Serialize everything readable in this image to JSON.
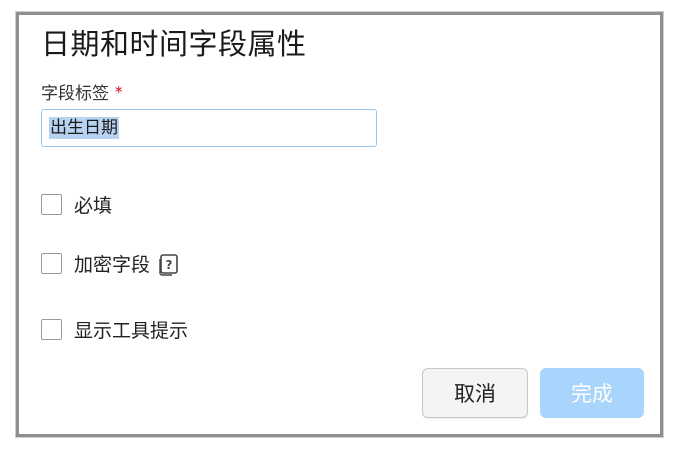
{
  "dialog": {
    "title": "日期和时间字段属性",
    "field_label": "字段标签",
    "required_marker": "*",
    "field_value": "出生日期",
    "checkboxes": [
      {
        "label": "必填",
        "checked": false
      },
      {
        "label": "加密字段",
        "checked": false,
        "has_help_icon": true,
        "help_icon": "help-icon"
      },
      {
        "label": "显示工具提示",
        "checked": false
      }
    ],
    "buttons": {
      "cancel_label": "取消",
      "done_label": "完成"
    }
  },
  "colors": {
    "required_star": "#d0021b",
    "input_border": "#9cc7ec",
    "selection_highlight": "#b8d3f2",
    "done_button_disabled": "#a9d4fb",
    "dialog_border": "#8f8f8f"
  }
}
